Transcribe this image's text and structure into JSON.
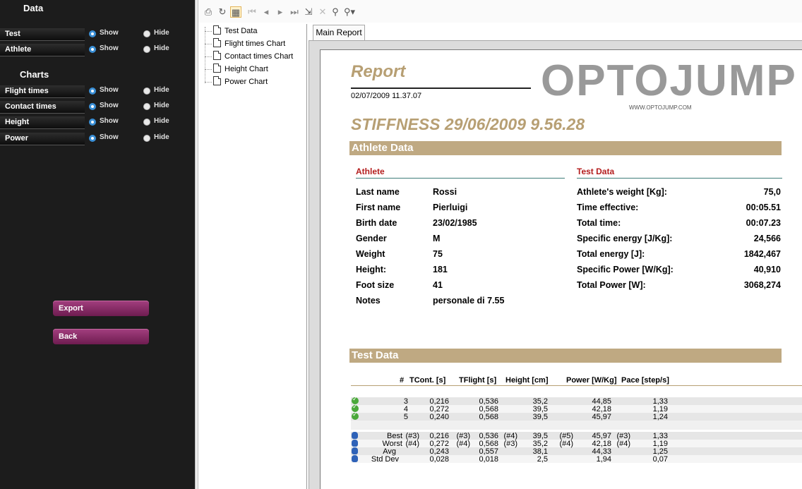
{
  "left_panel": {
    "data_title": "Data",
    "charts_title": "Charts",
    "show_label": "Show",
    "hide_label": "Hide",
    "data_rows": [
      {
        "label": "Test",
        "selected": "show"
      },
      {
        "label": "Athlete",
        "selected": "show"
      }
    ],
    "chart_rows": [
      {
        "label": "Flight times",
        "selected": "show"
      },
      {
        "label": "Contact times",
        "selected": "show"
      },
      {
        "label": "Height",
        "selected": "show"
      },
      {
        "label": "Power",
        "selected": "show"
      }
    ],
    "export_label": "Export",
    "back_label": "Back",
    "accent_color": "#3a8fd6",
    "button_color": "#8e2d6b"
  },
  "toolbar": {
    "icons": [
      "print-icon",
      "refresh-icon",
      "tree-toggle-icon",
      "first-page-icon",
      "prev-page-icon",
      "next-page-icon",
      "last-page-icon",
      "export-icon",
      "close-icon",
      "find-icon",
      "find-next-icon"
    ]
  },
  "tree": {
    "items": [
      "Test Data",
      "Flight times Chart",
      "Contact times Chart",
      "Height Chart",
      "Power Chart"
    ]
  },
  "tab": {
    "label": "Main Report"
  },
  "report": {
    "title": "Report",
    "date": "02/07/2009  11.37.07",
    "logo": "OPTOJUMP",
    "logo_url": "WWW.OPTOJUMP.COM",
    "test_title": "STIFFNESS 29/06/2009 9.56.28",
    "athlete_band": "Athlete Data",
    "athlete_heading": "Athlete",
    "test_heading": "Test Data",
    "athlete_fields": [
      {
        "label": "Last name",
        "value": "Rossi"
      },
      {
        "label": "First name",
        "value": "Pierluigi"
      },
      {
        "label": "Birth date",
        "value": "23/02/1985"
      },
      {
        "label": "Gender",
        "value": "M"
      },
      {
        "label": "Weight",
        "value": "75"
      },
      {
        "label": "Height:",
        "value": "181"
      },
      {
        "label": "Foot size",
        "value": "41"
      },
      {
        "label": "Notes",
        "value": "personale di 7.55"
      }
    ],
    "test_fields": [
      {
        "label": "Athlete's weight [Kg]:",
        "value": "75,0"
      },
      {
        "label": "Time effective:",
        "value": "00:05.51"
      },
      {
        "label": "Total time:",
        "value": "00:07.23"
      },
      {
        "label": "Specific energy [J/Kg]:",
        "value": "24,566"
      },
      {
        "label": "Total energy [J]:",
        "value": "1842,467"
      },
      {
        "label": "Specific Power [W/Kg]:",
        "value": "40,910"
      },
      {
        "label": "Total Power [W]:",
        "value": "3068,274"
      }
    ],
    "test_band": "Test Data",
    "columns": [
      "#",
      "TCont. [s]",
      "TFlight [s]",
      "Height [cm]",
      "Power [W/Kg]",
      "Pace [step/s]"
    ],
    "rows": [
      {
        "n": "3",
        "tcont": "0,216",
        "tflight": "0,536",
        "height": "35,2",
        "power": "44,85",
        "pace": "1,33"
      },
      {
        "n": "4",
        "tcont": "0,272",
        "tflight": "0,568",
        "height": "39,5",
        "power": "42,18",
        "pace": "1,19"
      },
      {
        "n": "5",
        "tcont": "0,240",
        "tflight": "0,568",
        "height": "39,5",
        "power": "45,97",
        "pace": "1,24"
      }
    ],
    "stats": [
      {
        "label": "Best",
        "tcont_ref": "(#3)",
        "tcont": "0,216",
        "tflight_ref": "(#3)",
        "tflight": "0,536",
        "height_ref": "(#4)",
        "height": "39,5",
        "power_ref": "(#5)",
        "power": "45,97",
        "pace_ref": "(#3)",
        "pace": "1,33"
      },
      {
        "label": "Worst",
        "tcont_ref": "(#4)",
        "tcont": "0,272",
        "tflight_ref": "(#4)",
        "tflight": "0,568",
        "height_ref": "(#3)",
        "height": "35,2",
        "power_ref": "(#4)",
        "power": "42,18",
        "pace_ref": "(#4)",
        "pace": "1,19"
      },
      {
        "label": "Avg",
        "tcont_ref": "",
        "tcont": "0,243",
        "tflight_ref": "",
        "tflight": "0,557",
        "height_ref": "",
        "height": "38,1",
        "power_ref": "",
        "power": "44,33",
        "pace_ref": "",
        "pace": "1,25"
      },
      {
        "label": "Std Dev",
        "tcont_ref": "",
        "tcont": "0,028",
        "tflight_ref": "",
        "tflight": "0,018",
        "height_ref": "",
        "height": "2,5",
        "power_ref": "",
        "power": "1,94",
        "pace_ref": "",
        "pace": "0,07"
      }
    ],
    "accent_color": "#bfa982"
  }
}
